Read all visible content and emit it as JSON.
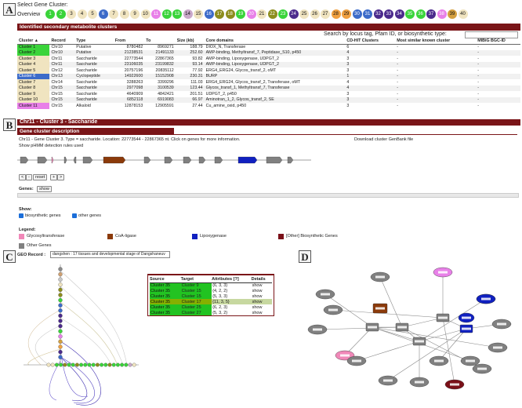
{
  "panels": {
    "a": "A",
    "b": "B",
    "c": "C",
    "d": "D"
  },
  "selector": {
    "title": "Select Gene Cluster:",
    "overview": "Overview",
    "clusters": [
      {
        "n": "1",
        "c": "#3ad43a"
      },
      {
        "n": "2",
        "c": "#3ad43a"
      },
      {
        "n": "3",
        "c": "#f0e4c0"
      },
      {
        "n": "4",
        "c": "#f0e4c0"
      },
      {
        "n": "5",
        "c": "#f0e4c0"
      },
      {
        "n": "6",
        "c": "#3c6bc9"
      },
      {
        "n": "7",
        "c": "#f0e4c0"
      },
      {
        "n": "8",
        "c": "#f0e4c0"
      },
      {
        "n": "9",
        "c": "#f0e4c0"
      },
      {
        "n": "10",
        "c": "#f0e4c0"
      },
      {
        "n": "11",
        "c": "#e880e8"
      },
      {
        "n": "12",
        "c": "#3ad43a"
      },
      {
        "n": "13",
        "c": "#3ad43a"
      },
      {
        "n": "14",
        "c": "#c9a8c9"
      },
      {
        "n": "15",
        "c": "#f0e4c0"
      },
      {
        "n": "16",
        "c": "#3c6bc9"
      },
      {
        "n": "17",
        "c": "#8d8d1c"
      },
      {
        "n": "18",
        "c": "#8d8d1c"
      },
      {
        "n": "19",
        "c": "#3ad43a"
      },
      {
        "n": "20",
        "c": "#e880e8"
      },
      {
        "n": "21",
        "c": "#f0e4c0"
      },
      {
        "n": "22",
        "c": "#8d8d1c"
      },
      {
        "n": "23",
        "c": "#3ad43a"
      },
      {
        "n": "24",
        "c": "#4b2a8c"
      },
      {
        "n": "25",
        "c": "#f0e4c0"
      },
      {
        "n": "26",
        "c": "#f0e4c0"
      },
      {
        "n": "27",
        "c": "#f0e4c0"
      },
      {
        "n": "28",
        "c": "#f0a040"
      },
      {
        "n": "29",
        "c": "#f0a040"
      },
      {
        "n": "30",
        "c": "#3c6bc9"
      },
      {
        "n": "31",
        "c": "#3c6bc9"
      },
      {
        "n": "32",
        "c": "#4b2a8c"
      },
      {
        "n": "33",
        "c": "#4b2a8c"
      },
      {
        "n": "34",
        "c": "#4b2a8c"
      },
      {
        "n": "35",
        "c": "#3ad43a"
      },
      {
        "n": "36",
        "c": "#3ad43a"
      },
      {
        "n": "37",
        "c": "#4b2a8c"
      },
      {
        "n": "38",
        "c": "#e880e8"
      },
      {
        "n": "39",
        "c": "#d4a040"
      },
      {
        "n": "40",
        "c": "#f0e4c0"
      }
    ]
  },
  "identified_title": "Identified secondary metabolite clusters",
  "search_label": "Search by locus tag, Pfam ID, or biosynthetic type:",
  "table": {
    "headers": [
      "Cluster",
      "Record",
      "Type",
      "From",
      "To",
      "Size (kb)",
      "Core domains",
      "CD-HIT Clusters",
      "Most similar known cluster",
      "MIBiG BGC-ID"
    ],
    "sort_glyph": "▲",
    "rows": [
      {
        "cluster": "Cluster 1",
        "color": "#3ad43a",
        "record": "Chr10",
        "type": "Putative",
        "from": "8780482",
        "to": "8969271",
        "size": "188.79",
        "core": "DIOX_N, Transferase",
        "cdhit": "6",
        "similar": "-",
        "mibig": "-"
      },
      {
        "cluster": "Cluster 2",
        "color": "#3ad43a",
        "record": "Chr10",
        "type": "Putative",
        "from": "21238531",
        "to": "21491133",
        "size": "252.60",
        "core": "AMP-binding, Methyltransf_7, Peptidase_S10, p450",
        "cdhit": "4",
        "similar": "-",
        "mibig": "-"
      },
      {
        "cluster": "Cluster 3",
        "color": "#f0e4c0",
        "record": "Chr11",
        "type": "Saccharide",
        "from": "22773544",
        "to": "22867365",
        "size": "93.82",
        "core": "AMP-binding, Lipoxygenase, UDPGT_2",
        "cdhit": "3",
        "similar": "-",
        "mibig": "-"
      },
      {
        "cluster": "Cluster 4",
        "color": "#f0e4c0",
        "record": "Chr11",
        "type": "Saccharide",
        "from": "23106035",
        "to": "23199832",
        "size": "93.14",
        "core": "AMP-binding, Lipoxygenase, UDPGT_2",
        "cdhit": "3",
        "similar": "-",
        "mibig": "-"
      },
      {
        "cluster": "Cluster 5",
        "color": "#f0e4c0",
        "record": "Chr12",
        "type": "Saccharide",
        "from": "20757196",
        "to": "20835112",
        "size": "77.92",
        "core": "ERG4_ERG24, Glycos_transf_2, oMT",
        "cdhit": "3",
        "similar": "-",
        "mibig": "-"
      },
      {
        "cluster": "Cluster 6",
        "color": "#3c6bc9",
        "record": "Chr13",
        "type": "Cyclopeptide",
        "from": "14922600",
        "to": "15152908",
        "size": "230.31",
        "core": "BURP",
        "cdhit": "1",
        "similar": "-",
        "mibig": "-"
      },
      {
        "cluster": "Cluster 7",
        "color": "#f0e4c0",
        "record": "Chr14",
        "type": "Saccharide",
        "from": "3288263",
        "to": "3399296",
        "size": "111.03",
        "core": "ERG4_ERG24, Glycos_transf_2, Transferase, oMT",
        "cdhit": "4",
        "similar": "-",
        "mibig": "-"
      },
      {
        "cluster": "Cluster 8",
        "color": "#f0e4c0",
        "record": "Chr15",
        "type": "Saccharide",
        "from": "2977098",
        "to": "3100539",
        "size": "123.44",
        "core": "Glycos_transf_1, Methyltransf_7, Transferase",
        "cdhit": "4",
        "similar": "-",
        "mibig": "-"
      },
      {
        "cluster": "Cluster 9",
        "color": "#f0e4c0",
        "record": "Chr15",
        "type": "Saccharide",
        "from": "4640909",
        "to": "4842421",
        "size": "201.51",
        "core": "UDPGT_2, p450",
        "cdhit": "3",
        "similar": "-",
        "mibig": "-"
      },
      {
        "cluster": "Cluster 10",
        "color": "#f0e4c0",
        "record": "Chr15",
        "type": "Saccharide",
        "from": "6852118",
        "to": "6919083",
        "size": "66.97",
        "core": "Aminotran_1_2, Glycos_transf_2, SE",
        "cdhit": "3",
        "similar": "-",
        "mibig": "-"
      },
      {
        "cluster": "Cluster 11",
        "color": "#e880e8",
        "record": "Chr15",
        "type": "Alkaloid",
        "from": "12878153",
        "to": "12905591",
        "size": "27.44",
        "core": "Cu_amine_oxid, p450",
        "cdhit": "3",
        "similar": "-",
        "mibig": "-"
      }
    ]
  },
  "gene": {
    "header": "Chr11 - Cluster 3 - Saccharide",
    "desc_title": "Gene cluster description",
    "desc_text": "Chr11 - Gene Cluster 3. Type = saccharide. Location: 22773544 - 22867365 nt. Click on genes for more information.",
    "download": "Download cluster GenBank file",
    "show_hmm": "Show pHMM detection rules used",
    "nav": [
      "<",
      "-",
      "reset",
      "+",
      ">"
    ],
    "genes_label": "Genes:",
    "show_btn": "show",
    "show_label": "Show:",
    "cb1": "biosynthetic genes",
    "cb2": "other genes",
    "legend_label": "Legend:",
    "legend": [
      {
        "label": "Glycosyltransferase",
        "color": "#f088b8"
      },
      {
        "label": "CoA-ligase",
        "color": "#8b3a0a"
      },
      {
        "label": "Lipoxygenase",
        "color": "#1020c0"
      },
      {
        "label": "[Other] Biosynthetic Genes",
        "color": "#7a1018"
      },
      {
        "label": "Other Genes",
        "color": "#808080"
      }
    ]
  },
  "geo": {
    "label": "GEO Record :",
    "select": "dangshen : 17 tissues and developmental stage of Dangshaneuv",
    "headers": [
      "Source",
      "Target",
      "Attributes [?]",
      "Details"
    ],
    "rows": [
      {
        "source": "Cluster 35",
        "target": "Cluster 9",
        "attr": "{6, 3, 3}",
        "details": "show",
        "hl": false
      },
      {
        "source": "Cluster 35",
        "target": "Cluster 15",
        "attr": "{4, 2, 2}",
        "details": "show",
        "hl": false
      },
      {
        "source": "Cluster 35",
        "target": "Cluster 15",
        "attr": "{5, 3, 3}",
        "details": "show",
        "hl": false
      },
      {
        "source": "Cluster 35",
        "target": "Cluster 17",
        "attr": "{11, 3, 5}",
        "details": "show",
        "hl": true
      },
      {
        "source": "Cluster 35",
        "target": "Cluster 25",
        "attr": "{6, 2, 3}",
        "details": "show",
        "hl": false
      },
      {
        "source": "Cluster 35",
        "target": "Cluster 27",
        "attr": "{5, 3, 2}",
        "details": "show",
        "hl": false
      }
    ]
  },
  "colors": {
    "accent": "#7a1518",
    "green": "#3ad43a",
    "purple": "#4b2a8c"
  }
}
